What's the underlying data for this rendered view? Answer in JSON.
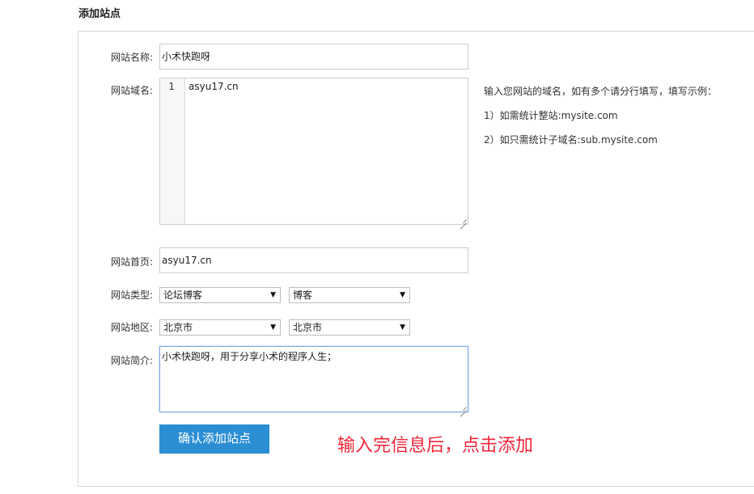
{
  "page": {
    "title": "添加站点"
  },
  "form": {
    "site_name": {
      "label": "网站名称:",
      "value": "小术快跑呀"
    },
    "domain": {
      "label": "网站域名:",
      "line_number": "1",
      "value": "asyu17.cn",
      "hint": {
        "intro": "输入您网站的域名，如有多个请分行填写，填写示例：",
        "example1": "1）如需统计整站:mysite.com",
        "example2": "2）如只需统计子域名:sub.mysite.com"
      }
    },
    "homepage": {
      "label": "网站首页:",
      "value": "asyu17.cn"
    },
    "site_type": {
      "label": "网站类型:",
      "primary": "论坛博客",
      "secondary": "博客"
    },
    "region": {
      "label": "网站地区:",
      "province": "北京市",
      "city": "北京市"
    },
    "intro": {
      "label": "网站简介:",
      "value": "小术快跑呀，用于分享小术的程序人生；"
    },
    "submit_label": "确认添加站点"
  },
  "annotation": {
    "text": "输入完信息后，点击添加",
    "color": "#f0263a"
  },
  "colors": {
    "accent": "#2b8ed3",
    "focus_border": "#7ea9e6"
  }
}
